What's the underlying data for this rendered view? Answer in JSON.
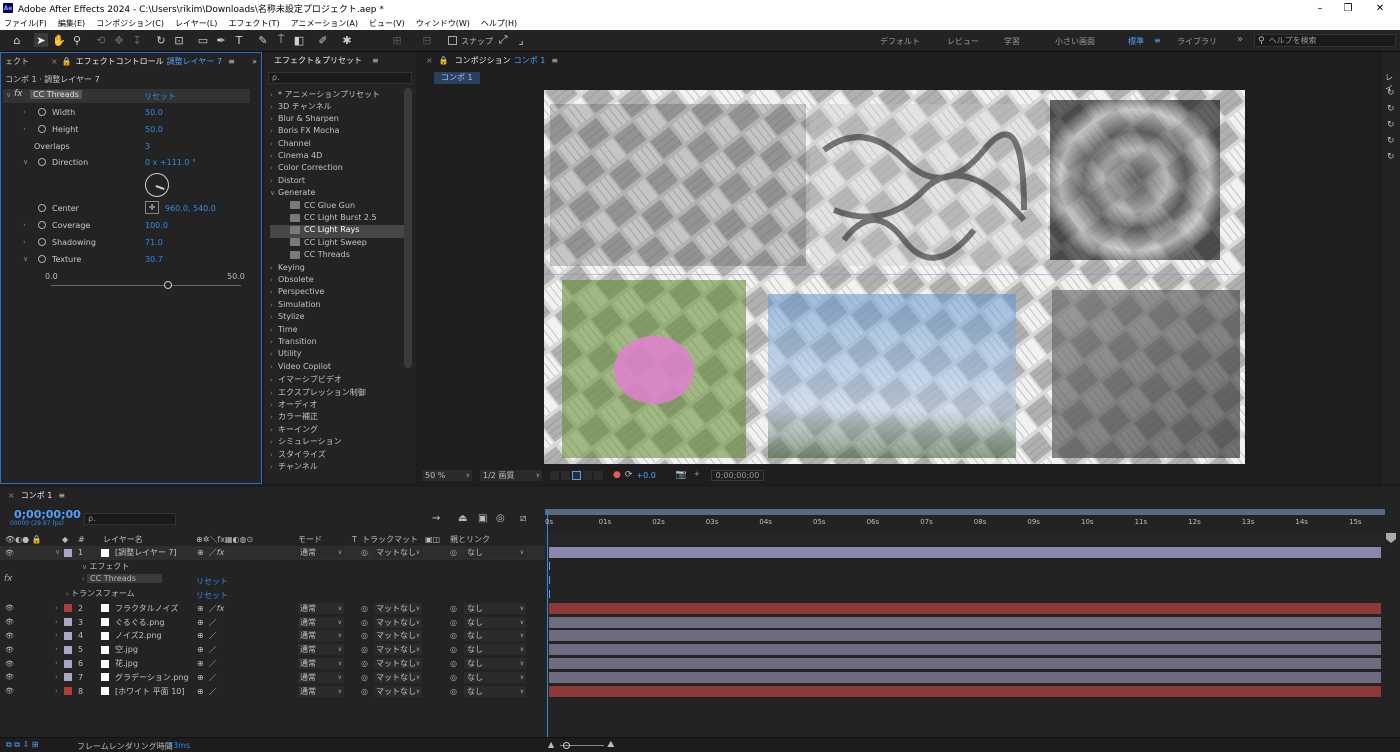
{
  "titlebar": {
    "app_icon": "Ae",
    "title": "Adobe After Effects 2024 - C:\\Users\\rikim\\Downloads\\名称未設定プロジェクト.aep *",
    "minimize": "–",
    "maximize": "❐",
    "close": "✕"
  },
  "menu": [
    "ファイル(F)",
    "編集(E)",
    "コンポジション(C)",
    "レイヤー(L)",
    "エフェクト(T)",
    "アニメーション(A)",
    "ビュー(V)",
    "ウィンドウ(W)",
    "ヘルプ(H)"
  ],
  "toolbar": {
    "snap_label": "スナップ",
    "workspaces": [
      "デフォルト",
      "レビュー",
      "学習",
      "小さい画面",
      "標準",
      "ライブラリ"
    ],
    "active_workspace": "標準",
    "more": "»",
    "search_placeholder": "ヘルプを検索"
  },
  "effect_controls": {
    "tab_left": "ェクト",
    "tab_label": "エフェクトコントロール",
    "tab_layer": "調整レイヤー 7",
    "breadcrumb": "コンポ 1 · 調整レイヤー 7",
    "effect_name": "CC Threads",
    "reset": "リセット",
    "props": [
      {
        "name": "Width",
        "value": "50.0"
      },
      {
        "name": "Height",
        "value": "50.0"
      },
      {
        "name": "Overlaps",
        "value": "3"
      },
      {
        "name": "Direction",
        "value": "0 x +111.0 °"
      },
      {
        "name": "Center",
        "value": "960.0, 540.0"
      },
      {
        "name": "Coverage",
        "value": "100.0"
      },
      {
        "name": "Shadowing",
        "value": "71.0"
      },
      {
        "name": "Texture",
        "value": "30.7"
      }
    ],
    "slider_min": "0.0",
    "slider_max": "50.0",
    "slider_value": 30.7
  },
  "effects_presets": {
    "tab_label": "エフェクト＆プリセット",
    "search_placeholder": "ρ.",
    "items": [
      "* アニメーションプリセット",
      "3D チャンネル",
      "Blur & Sharpen",
      "Boris FX Mocha",
      "Channel",
      "Cinema 4D",
      "Color Correction",
      "Distort",
      "Generate"
    ],
    "generate_children": [
      "CC Glue Gun",
      "CC Light Burst 2.5",
      "CC Light Rays",
      "CC Light Sweep",
      "CC Threads"
    ],
    "selected_child": "CC Light Rays",
    "items_after": [
      "Keying",
      "Obsolete",
      "Perspective",
      "Simulation",
      "Stylize",
      "Time",
      "Transition",
      "Utility",
      "Video Copilot",
      "イマーシブビデオ",
      "エクスプレッション制御",
      "オーディオ",
      "カラー補正",
      "キーイング",
      "シミュレーション",
      "スタイライズ",
      "チャンネル"
    ]
  },
  "composition": {
    "tab_prefix": "コンポジション",
    "tab_comp": "コンポ 1",
    "subtab": "コンポ 1",
    "zoom": "50 %",
    "resolution": "1/2 画質",
    "exposure": "+0.0",
    "timecode": "0;00;00;00"
  },
  "timeline": {
    "tab": "コンポ 1",
    "timecode": "0;00;00;00",
    "fps": "00000 (29.97 fps)",
    "search_placeholder": "ρ.",
    "headers": {
      "hash": "#",
      "layer_name": "レイヤー名",
      "mode": "モード",
      "t": "T",
      "track_matte": "トラックマット",
      "parent": "親とリンク"
    },
    "ruler": [
      "0s",
      "01s",
      "02s",
      "03s",
      "04s",
      "05s",
      "06s",
      "07s",
      "08s",
      "09s",
      "10s",
      "11s",
      "12s",
      "13s",
      "14s",
      "15s"
    ],
    "layers": [
      {
        "num": "1",
        "name": "[調整レイヤー 7]",
        "mode": "通常",
        "matte": "マットなし",
        "parent": "なし",
        "label": "#a9a6c6",
        "bar": "#8a88b0",
        "fx": true
      },
      {
        "num": "2",
        "name": "フラクタルノイズ",
        "mode": "通常",
        "matte": "マットなし",
        "parent": "なし",
        "label": "#b23c3c",
        "bar": "#8e3838",
        "fx": true
      },
      {
        "num": "3",
        "name": "ぐるぐる.png",
        "mode": "通常",
        "matte": "マットなし",
        "parent": "なし",
        "label": "#a9a6c6",
        "bar": "#6d6c80",
        "fx": false
      },
      {
        "num": "4",
        "name": "ノイズ2.png",
        "mode": "通常",
        "matte": "マットなし",
        "parent": "なし",
        "label": "#a9a6c6",
        "bar": "#6d6c80",
        "fx": false
      },
      {
        "num": "5",
        "name": "空.jpg",
        "mode": "通常",
        "matte": "マットなし",
        "parent": "なし",
        "label": "#a9a6c6",
        "bar": "#6d6c80",
        "fx": false
      },
      {
        "num": "6",
        "name": "花.jpg",
        "mode": "通常",
        "matte": "マットなし",
        "parent": "なし",
        "label": "#a9a6c6",
        "bar": "#6d6c80",
        "fx": false
      },
      {
        "num": "7",
        "name": "グラデーション.png",
        "mode": "通常",
        "matte": "マットなし",
        "parent": "なし",
        "label": "#a9a6c6",
        "bar": "#6d6c80",
        "fx": false
      },
      {
        "num": "8",
        "name": "[ホワイト 平面 10]",
        "mode": "通常",
        "matte": "マットなし",
        "parent": "なし",
        "label": "#b23c3c",
        "bar": "#8e3838",
        "fx": false
      }
    ],
    "sub_effect": "エフェクト",
    "sub_effect_name": "CC Threads",
    "sub_reset": "リセット",
    "sub_transform": "トランスフォーム",
    "sub_transform_reset": "リセット",
    "footer_label": "フレームレンダリング時間",
    "footer_value": "13ms"
  }
}
